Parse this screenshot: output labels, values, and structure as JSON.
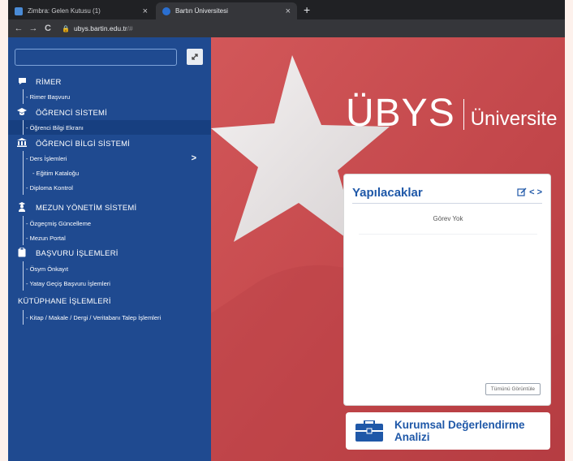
{
  "browser": {
    "tabs": [
      {
        "title": "Zimbra: Gelen Kutusu (1)",
        "close": "×",
        "favicon_color": "#4a8bd6"
      },
      {
        "title": "Bartın Üniversitesi",
        "close": "×",
        "favicon_color": "#2a6fd1"
      }
    ],
    "new_tab": "+",
    "back": "←",
    "forward": "→",
    "reload": "C",
    "url_host": "ubys.bartin.edu.tr",
    "url_rest": "/#"
  },
  "sidebar": {
    "search_placeholder": "",
    "search_button_icon": "expand-icon",
    "sections": [
      {
        "label": "RİMER",
        "icon": "speech-bubble-icon"
      },
      {
        "label": "ÖĞRENCİ SİSTEMİ",
        "icon": "graduation-cap-icon"
      },
      {
        "label": "ÖĞRENCİ BİLGİ SİSTEMİ",
        "icon": "institution-icon"
      },
      {
        "label": "MEZUN YÖNETİM SİSTEMİ",
        "icon": "graduate-user-icon"
      },
      {
        "label": "BAŞVURU İŞLEMLERİ",
        "icon": "clipboard-icon"
      },
      {
        "label": "KÜTÜPHANE İŞLEMLERİ",
        "icon": ""
      }
    ],
    "items": [
      "- Rimer Başvuru",
      "- Öğrenci Bilgi Ekranı",
      "- Ders İşlemleri",
      "- Eğitim Kataloğu",
      "- Diploma Kontrol",
      "- Özgeçmiş Güncelleme",
      "- Mezun Portal",
      "- Ösym Önkayıt",
      "- Yatay Geçiş Başvuru İşlemleri",
      "- Kitap / Makale / Dergi / Veritabanı Talep İşlemleri"
    ],
    "chevron": ">"
  },
  "hero": {
    "logo_main": "ÜBYS",
    "logo_sub": "Üniversite"
  },
  "todo": {
    "title": "Yapılacaklar",
    "edit_icon": "edit-icon",
    "prev_icon": "<",
    "next_icon": ">",
    "empty_text": "Görev Yok",
    "view_all": "Tümünü Görüntüle"
  },
  "kurumsal": {
    "line1": "Kurumsal Değerlendirme",
    "line2": "Analizi",
    "icon": "briefcase-icon"
  },
  "colors": {
    "sidebar": "#1f4a90",
    "accent": "#1f58a8",
    "background_red": "#c94c4f"
  }
}
